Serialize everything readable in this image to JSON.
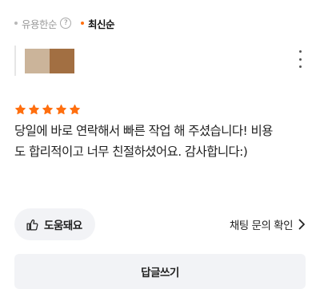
{
  "sort": {
    "options": [
      {
        "label": "유용한순",
        "active": false
      },
      {
        "label": "최신순",
        "active": true
      }
    ],
    "help_glyph": "?"
  },
  "colors": {
    "accent": "#ff6f0f",
    "button_bg": "#f2f3f6"
  },
  "review": {
    "rating": 5,
    "rating_max": 5,
    "text": "당일에 바로 연락해서 빠른 작업 해 주셨습니다! 비용\n도 합리적이고 너무 친절하셨어요. 감사합니다:)"
  },
  "actions": {
    "helpful_label": "도움돼요",
    "chat_link_label": "채팅 문의 확인",
    "reply_label": "답글쓰기"
  },
  "icons": {
    "help": "question-circle-icon",
    "more": "more-vertical-icon",
    "star": "star-icon",
    "thumbs_up": "thumbs-up-icon",
    "chevron": "chevron-right-icon"
  }
}
